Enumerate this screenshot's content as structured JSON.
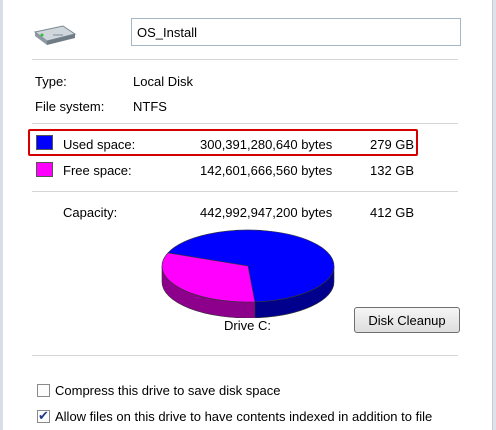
{
  "drive": {
    "name_value": "OS_Install",
    "icon": "hard-drive-icon"
  },
  "info": {
    "type_label": "Type:",
    "type_value": "Local Disk",
    "fs_label": "File system:",
    "fs_value": "NTFS"
  },
  "space": {
    "used": {
      "label": "Used space:",
      "bytes": "300,391,280,640 bytes",
      "size": "279 GB",
      "color": "#0000ff",
      "fraction": 0.678
    },
    "free": {
      "label": "Free space:",
      "bytes": "142,601,666,560 bytes",
      "size": "132 GB",
      "color": "#ff00ff",
      "fraction": 0.322
    },
    "capacity": {
      "label": "Capacity:",
      "bytes": "442,992,947,200 bytes",
      "size": "412 GB"
    }
  },
  "drive_label": "Drive C:",
  "cleanup_button": "Disk Cleanup",
  "options": {
    "compress": {
      "label": "Compress this drive to save disk space",
      "checked": false
    },
    "index": {
      "label": "Allow files on this drive to have contents indexed in addition to file",
      "checked": true
    }
  },
  "highlight_color": "#d40000"
}
